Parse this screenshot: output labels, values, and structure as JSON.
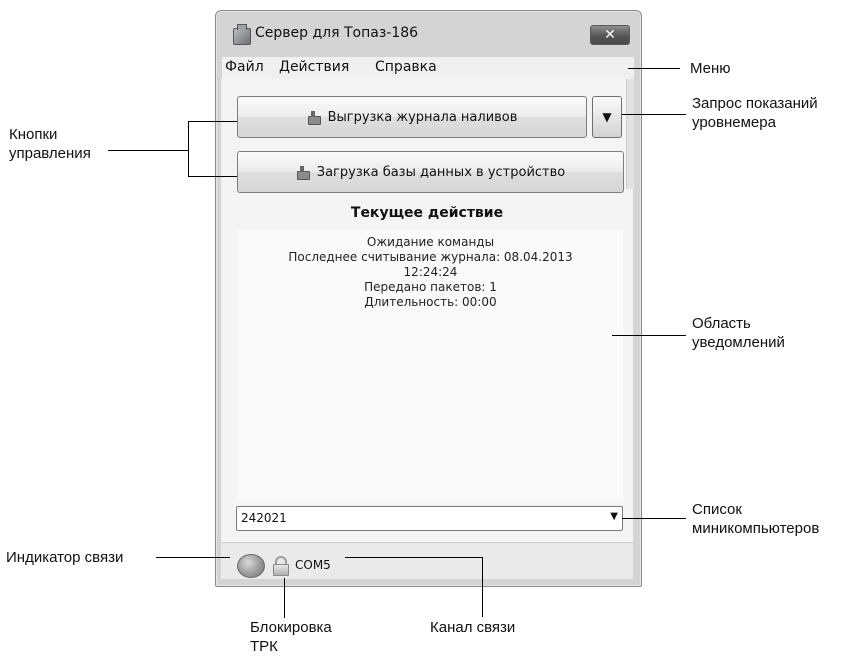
{
  "window": {
    "title": "Сервер для Топаз-186",
    "close_label": "✕"
  },
  "menu": {
    "items": [
      "Файл",
      "Действия",
      "Справка"
    ]
  },
  "buttons": {
    "export_journal": "Выгрузка журнала наливов",
    "load_database": "Загрузка базы данных в устройство",
    "dropdown_arrow": "▼"
  },
  "current_action": {
    "title": "Текущее действие",
    "lines": [
      "Ожидание команды",
      "Последнее считывание журнала: 08.04.2013",
      "12:24:24",
      "Передано пакетов: 1",
      "Длительность: 00:00"
    ]
  },
  "minicomputers": {
    "selected": "242021",
    "arrow": "▼"
  },
  "status": {
    "channel": "COM5"
  },
  "callouts": {
    "menu": "Меню",
    "level_query": [
      "Запрос показаний",
      "уровнемера"
    ],
    "control_buttons": [
      "Кнопки",
      "управления"
    ],
    "notification_area": [
      "Область",
      "уведомлений"
    ],
    "minicomputer_list": [
      "Список",
      "миникомпьютеров"
    ],
    "link_indicator": "Индикатор связи",
    "trk_lock": [
      "Блокировка",
      "ТРК"
    ],
    "link_channel": "Канал связи"
  },
  "colors": {
    "window_frame": "#d4d4d4",
    "client": "#f4f4f4",
    "close_button": "#565656"
  }
}
